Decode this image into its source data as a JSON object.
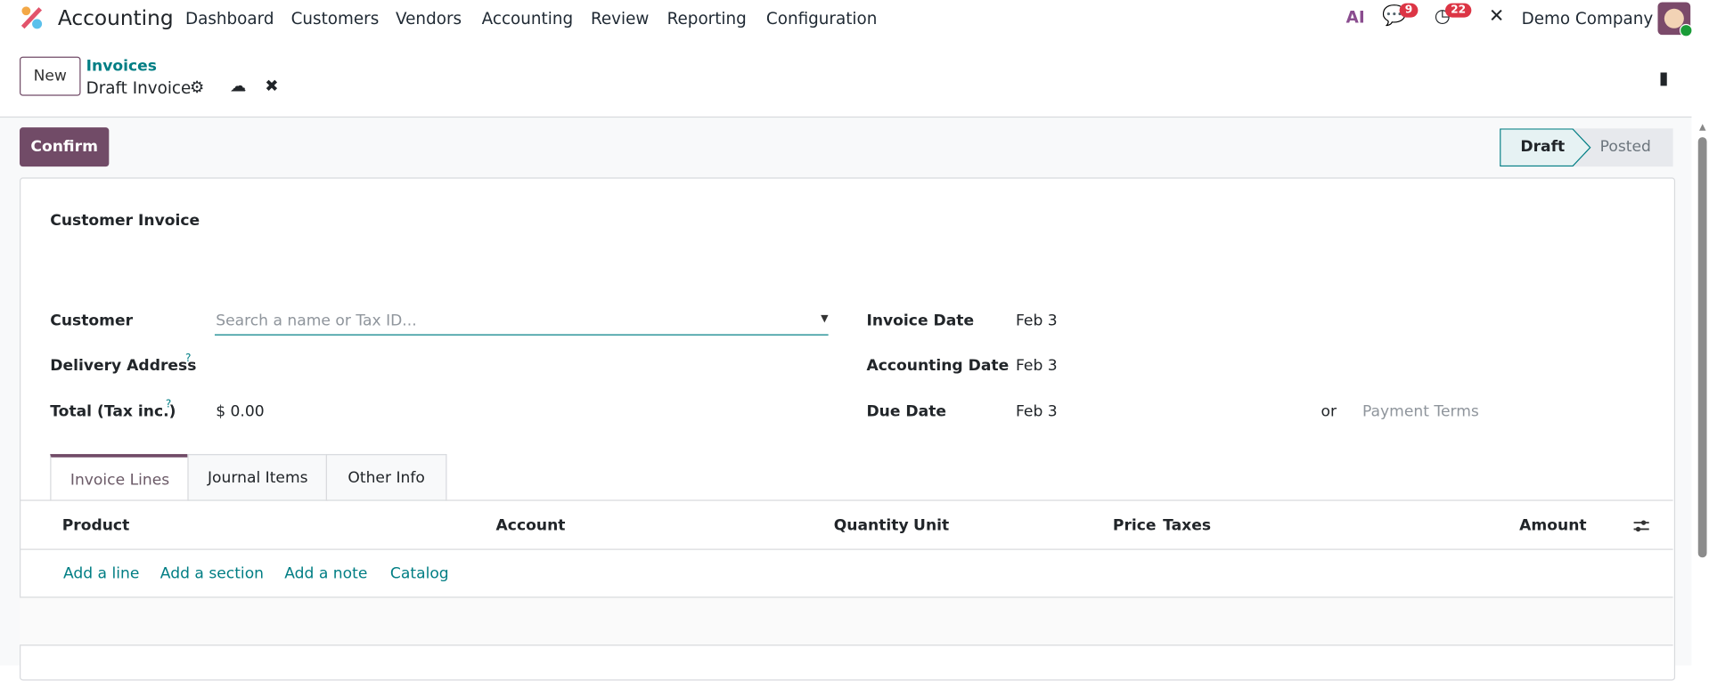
{
  "navbar": {
    "app": "Accounting",
    "menu": [
      "Dashboard",
      "Customers",
      "Vendors",
      "Accounting",
      "Review",
      "Reporting",
      "Configuration"
    ],
    "messages_count": "9",
    "activities_count": "22",
    "company": "Demo Company",
    "ai_label": "AI"
  },
  "control": {
    "new_label": "New",
    "breadcrumb_parent": "Invoices",
    "breadcrumb_current": "Draft Invoice"
  },
  "actions": {
    "confirm": "Confirm"
  },
  "statusbar": {
    "stages": [
      "Draft",
      "Posted"
    ],
    "active": "Draft"
  },
  "form": {
    "type_title": "Customer Invoice",
    "customer_label": "Customer",
    "customer_placeholder": "Search a name or Tax ID...",
    "delivery_label": "Delivery Address",
    "total_label": "Total (Tax inc.)",
    "total_value": "$ 0.00",
    "help": "?",
    "invoice_date_label": "Invoice Date",
    "invoice_date": "Feb 3",
    "accounting_date_label": "Accounting Date",
    "accounting_date": "Feb 3",
    "due_date_label": "Due Date",
    "due_date": "Feb 3",
    "or": "or",
    "payment_terms_placeholder": "Payment Terms"
  },
  "tabs": [
    "Invoice Lines",
    "Journal Items",
    "Other Info"
  ],
  "lines": {
    "columns": [
      "Product",
      "Account",
      "Quantity",
      "Unit",
      "Price",
      "Taxes",
      "Amount"
    ],
    "links": [
      "Add a line",
      "Add a section",
      "Add a note",
      "Catalog"
    ]
  },
  "colors": {
    "brand": "#714b67",
    "link": "#017e84"
  }
}
